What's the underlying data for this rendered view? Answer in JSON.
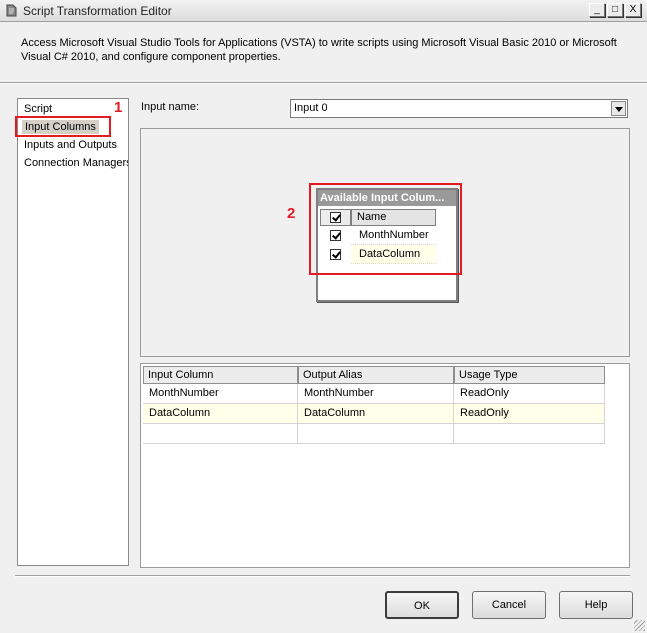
{
  "window": {
    "title": "Script Transformation Editor",
    "controls": {
      "minimize": "_",
      "maximize": "□",
      "close": "X"
    }
  },
  "description": "Access Microsoft Visual Studio Tools for Applications (VSTA) to write scripts using Microsoft Visual Basic 2010 or Microsoft Visual C# 2010, and configure component properties.",
  "nav": {
    "items": [
      "Script",
      "Input Columns",
      "Inputs and Outputs",
      "Connection Managers"
    ],
    "selected": "Input Columns"
  },
  "callouts": {
    "first": "1",
    "second": "2"
  },
  "input": {
    "label": "Input name:",
    "value": "Input 0"
  },
  "available_columns": {
    "title": "Available Input Colum...",
    "header": "Name",
    "rows": [
      {
        "name": "MonthNumber",
        "checked": true
      },
      {
        "name": "DataColumn",
        "checked": true
      }
    ]
  },
  "grid": {
    "headers": [
      "Input Column",
      "Output Alias",
      "Usage Type"
    ],
    "rows": [
      [
        "MonthNumber",
        "MonthNumber",
        "ReadOnly"
      ],
      [
        "DataColumn",
        "DataColumn",
        "ReadOnly"
      ]
    ]
  },
  "buttons": {
    "ok": "OK",
    "cancel": "Cancel",
    "help": "Help"
  },
  "colors": {
    "highlight": "#e31b23",
    "alt_row": "#ffffea"
  }
}
